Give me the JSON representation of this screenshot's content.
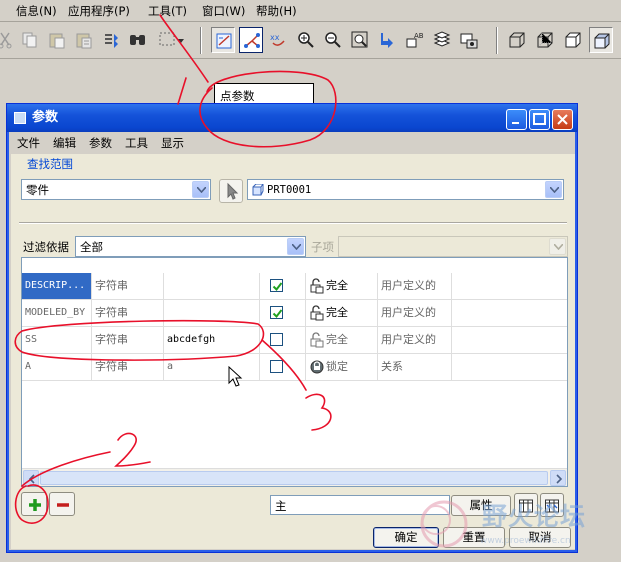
{
  "app_menubar": {
    "items": [
      "信息(N)",
      "应用程序(P)",
      "工具(T)",
      "窗口(W)",
      "帮助(H)"
    ]
  },
  "toolbar": {
    "icons": [
      "cut-icon",
      "copy-icon",
      "paste-icon",
      "paste-special-icon",
      "regenerate-icon",
      "find-icon",
      "select-box-icon",
      "datum-plane-display-icon",
      "datum-axis-display-icon",
      "datum-point-display-icon",
      "zoom-in-icon",
      "zoom-out-icon",
      "refit-icon",
      "spin-center-icon",
      "annotation-icon",
      "layers-icon",
      "saved-views-icon",
      "wireframe-icon",
      "hidden-line-icon",
      "no-hidden-icon",
      "shading-icon"
    ]
  },
  "tooltip": {
    "text": "点参数"
  },
  "dialog": {
    "title": "参数",
    "menu": [
      "文件",
      "编辑",
      "参数",
      "工具",
      "显示"
    ],
    "scope_label": "查找范围",
    "scope_type": "零件",
    "scope_object": "PRT0001",
    "filter_label": "过滤依据",
    "filter_value": "全部",
    "subitem_label": "子项",
    "rows": [
      {
        "name": "DESCRIP...",
        "type": "字符串",
        "value": "",
        "designated": true,
        "access": "完全",
        "source": "用户定义的"
      },
      {
        "name": "MODELED_BY",
        "type": "字符串",
        "value": "",
        "designated": true,
        "access": "完全",
        "source": "用户定义的"
      },
      {
        "name": "SS",
        "type": "字符串",
        "value": "abcdefgh",
        "designated": false,
        "access": "完全",
        "source": "用户定义的"
      },
      {
        "name": "A",
        "type": "字符串",
        "value": "a",
        "designated": false,
        "access": "锁定",
        "source": "关系"
      }
    ],
    "main_field": "主",
    "properties_label": "属性",
    "ok_label": "确定",
    "reset_label": "重置",
    "cancel_label": "取消"
  },
  "annotations": {
    "labels": [
      "1",
      "2",
      "3"
    ]
  },
  "watermark": {
    "text": "野火论坛",
    "url": "www.proewildfire.cn"
  },
  "colors": {
    "annotation_red": "#e8102a",
    "selection_blue": "#316ac5",
    "title_blue": "#0a46cf"
  }
}
